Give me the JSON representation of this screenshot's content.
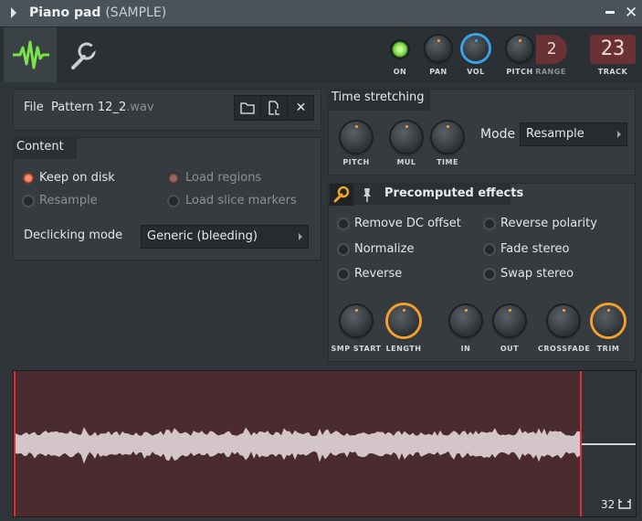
{
  "window": {
    "title": "Piano pad",
    "subtitle": "(SAMPLE)"
  },
  "toolbar": {
    "on_label": "ON",
    "pan_label": "PAN",
    "vol_label": "VOL",
    "pitch_label": "PITCH",
    "range_label": "RANGE",
    "range_value": "2",
    "track_label": "TRACK",
    "track_value": "23"
  },
  "file": {
    "label": "File",
    "name": "Pattern 12_2",
    "ext": ".wav"
  },
  "content": {
    "header": "Content",
    "keep_on_disk": "Keep on disk",
    "resample": "Resample",
    "load_regions": "Load regions",
    "load_slice_markers": "Load slice markers",
    "declicking_label": "Declicking mode",
    "declicking_value": "Generic (bleeding)"
  },
  "time_stretching": {
    "header": "Time stretching",
    "pitch": "PITCH",
    "mul": "MUL",
    "time": "TIME",
    "mode_label": "Mode",
    "mode_value": "Resample"
  },
  "precomputed": {
    "header": "Precomputed effects",
    "remove_dc": "Remove DC offset",
    "normalize": "Normalize",
    "reverse": "Reverse",
    "reverse_polarity": "Reverse polarity",
    "fade_stereo": "Fade stereo",
    "swap_stereo": "Swap stereo",
    "smp_start": "SMP START",
    "length": "LENGTH",
    "in": "IN",
    "out": "OUT",
    "crossfade": "CROSSFADE",
    "trim": "TRIM"
  },
  "waveform": {
    "zoom": "32"
  },
  "colors": {
    "accent_orange": "#f2a22c",
    "accent_blue": "#3aa3e8",
    "led_green": "#6fd13a",
    "marker_red": "#e0303a"
  }
}
